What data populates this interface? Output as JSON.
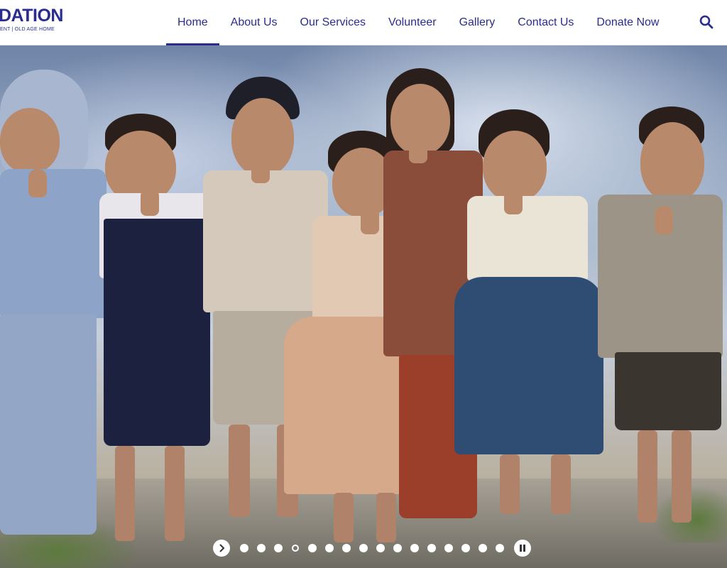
{
  "brand": {
    "name": "DATION",
    "tagline": "ENT | OLD AGE HOME"
  },
  "nav": {
    "items": [
      {
        "label": "Home",
        "active": true
      },
      {
        "label": "About Us",
        "active": false
      },
      {
        "label": "Our Services",
        "active": false
      },
      {
        "label": "Volunteer",
        "active": false
      },
      {
        "label": "Gallery",
        "active": false
      },
      {
        "label": "Contact Us",
        "active": false
      },
      {
        "label": "Donate Now",
        "active": false
      }
    ],
    "search_icon": "search-icon"
  },
  "hero": {
    "slide_count": 16,
    "active_slide": 4,
    "controls": {
      "next_icon": "chevron-right-icon",
      "pause_icon": "pause-icon"
    }
  },
  "colors": {
    "brand": "#2a2d8f",
    "header_bg": "#ffffff",
    "dot": "#ffffff"
  }
}
